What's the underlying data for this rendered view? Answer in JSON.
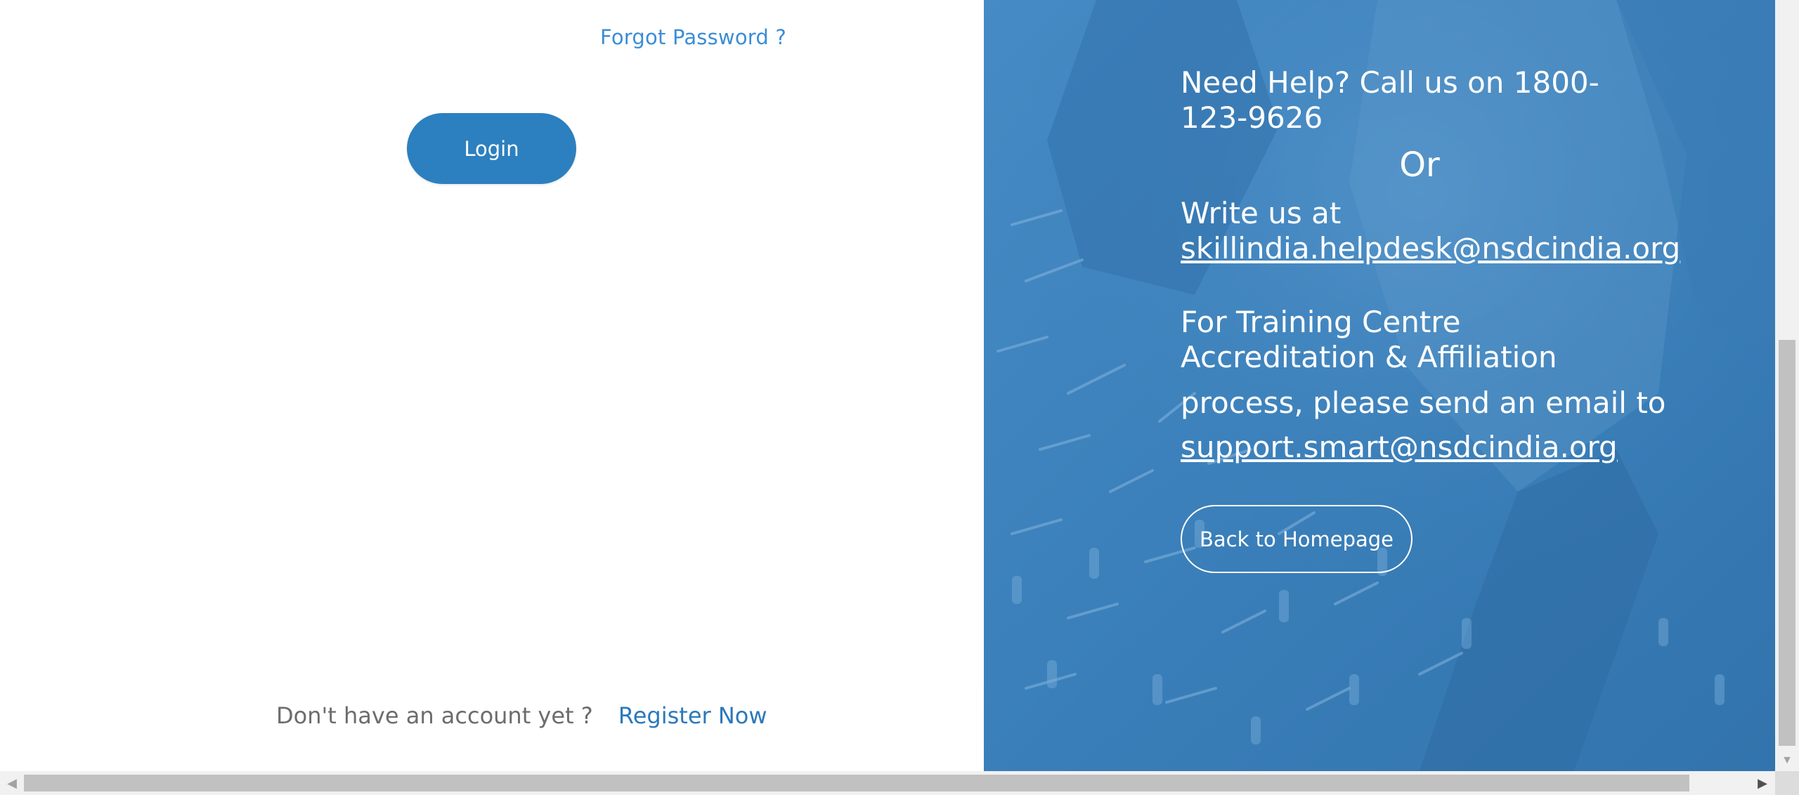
{
  "login": {
    "forgot_password": "Forgot Password ?",
    "login_button": "Login",
    "no_account_text": "Don't have an account yet ?",
    "register_link": "Register Now"
  },
  "help": {
    "phone_line": "Need Help? Call us on 1800-123-9626",
    "or_text": "Or",
    "write_text": "Write us at",
    "helpdesk_email": "skillindia.helpdesk@nsdcindia.org",
    "accreditation_text": "For Training Centre Accreditation & Affiliation",
    "process_text": "process, please send an email to",
    "support_email": "support.smart@nsdcindia.org",
    "back_button": "Back to Homepage"
  },
  "scrollbars": {
    "up_arrow_icon": "chevron-up-icon",
    "down_arrow_icon": "chevron-down-icon",
    "left_arrow_icon": "caret-left-icon",
    "right_arrow_icon": "caret-right-icon"
  },
  "colors": {
    "accent": "#2c80bf",
    "link": "#3c8dd6",
    "panel": "#3a7fb9",
    "text_muted": "#6c6c6c"
  }
}
